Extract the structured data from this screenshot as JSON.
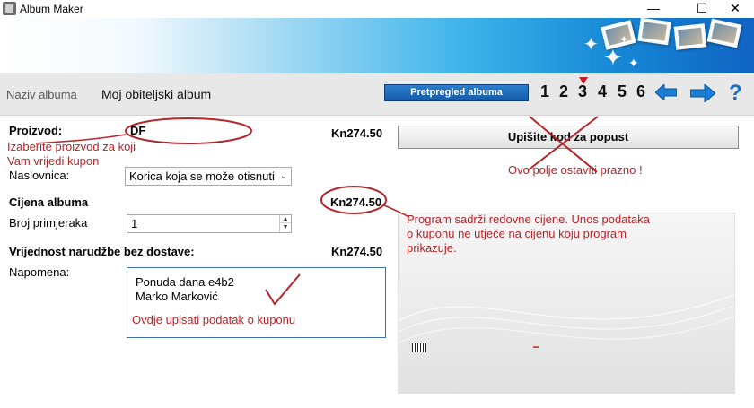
{
  "window": {
    "title": "Album Maker",
    "minimize_glyph": "—",
    "maximize_glyph": "☐",
    "close_glyph": "✕"
  },
  "toolbar": {
    "album_label": "Naziv albuma",
    "album_name": "Moj obiteljski album",
    "preview_label": "Pretpregled albuma",
    "steps": [
      "1",
      "2",
      "3",
      "4",
      "5",
      "6"
    ],
    "current_step": "3",
    "help_glyph": "?"
  },
  "form": {
    "product_label": "Proizvod:",
    "product_value": "DF",
    "product_price": "Kn274.50",
    "cover_label": "Naslovnica:",
    "cover_selected": "Korica koja se može otisnuti",
    "album_price_label": "Cijena albuma",
    "album_price": "Kn274.50",
    "copies_label": "Broj primjeraka",
    "copies_value": "1",
    "order_value_label": "Vrijednost narudžbe bez dostave:",
    "order_value": "Kn274.50",
    "note_label": "Napomena:",
    "note_lines": [
      "Ponuda dana e4b2",
      "Marko Marković"
    ]
  },
  "coupon": {
    "button_label": "Upišite kod za popust"
  },
  "annotations": {
    "choose_product_line1": "Izaberite proizvod za koji",
    "choose_product_line2": "Vam vrijedi kupon",
    "leave_empty": "Ovo polje ostaviti prazno !",
    "program_prices_line1": "Program sadrži redovne cijene. Unos podataka",
    "program_prices_line2": "o kuponu ne utječe na cijenu koju program",
    "program_prices_line3": "prikazuje.",
    "enter_coupon": "Ovdje upisati podatak o kuponu"
  },
  "colors": {
    "annotation_red": "#b3262b",
    "preview_blue": "#1b64b5",
    "arrow_blue": "#1b7fd6",
    "step_marker": "#c41f2d"
  },
  "icons": {
    "back": "arrow-left-icon",
    "forward": "arrow-right-icon",
    "help": "help-icon"
  }
}
